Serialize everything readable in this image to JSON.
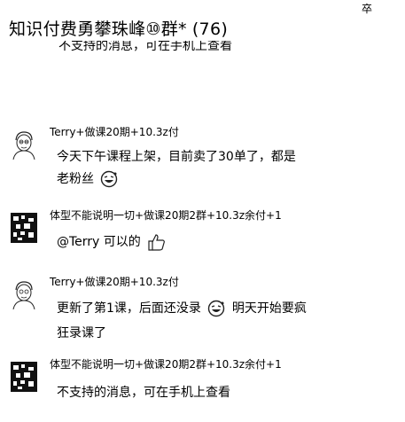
{
  "top_glyph": "卒",
  "group": {
    "title": "知识付费勇攀珠峰⑩群*",
    "count": "(76)"
  },
  "partial_message": "不支持的消息，可在手机上查看",
  "messages": [
    {
      "avatar_icon": "person-sketch-avatar-icon",
      "sender": "Terry+做课20期+10.3z付",
      "lines": [
        "今天下午课程上架，目前卖了30单了，都是",
        "老粉丝"
      ],
      "trailing_icon": "laughing-emoji-icon"
    },
    {
      "avatar_icon": "pixel-pattern-avatar-icon",
      "sender": "体型不能说明一切+做课20期2群+10.3z余付+1",
      "lines": [
        "@Terry 可以的"
      ],
      "trailing_icon": "thumbs-up-emoji-icon"
    },
    {
      "avatar_icon": "person-sketch-avatar-icon",
      "sender": "Terry+做课20期+10.3z付",
      "lines": [
        "更新了第1课，后面还没录",
        "明天开始要疯",
        "狂录课了"
      ],
      "inline_icon": "laughing-emoji-icon"
    },
    {
      "avatar_icon": "pixel-pattern-avatar-icon",
      "sender": "体型不能说明一切+做课20期2群+10.3z余付+1",
      "lines": [
        "不支持的消息，可在手机上查看"
      ]
    }
  ]
}
